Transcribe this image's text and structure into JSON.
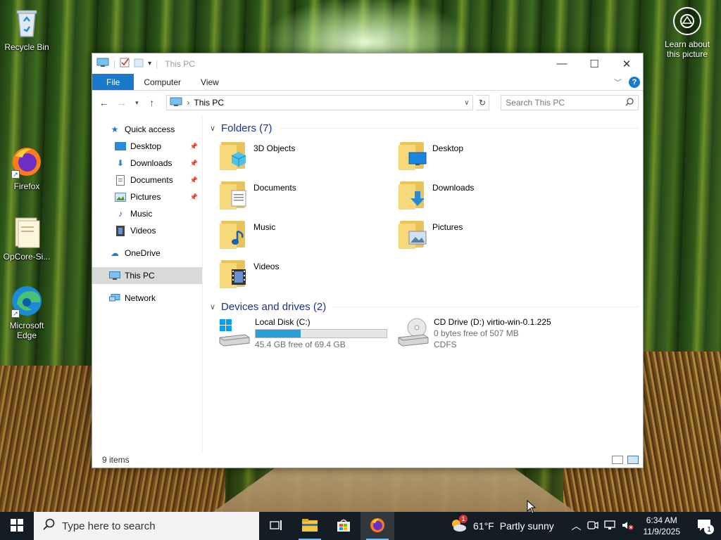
{
  "desktop": {
    "icons": [
      {
        "label": "Recycle Bin",
        "icon": "recycle-bin-icon"
      },
      {
        "label": "Firefox",
        "icon": "firefox-icon"
      },
      {
        "label": "OpCore-Si...",
        "icon": "file-icon"
      },
      {
        "label": "Microsoft Edge",
        "icon": "edge-icon"
      }
    ],
    "learn_about": "Learn about this picture"
  },
  "window": {
    "title": "This PC",
    "ribbon_tabs": [
      "File",
      "Computer",
      "View"
    ],
    "address": {
      "path": "This PC"
    },
    "search": {
      "placeholder": "Search This PC"
    },
    "nav": {
      "quick_access": "Quick access",
      "quick_items": [
        "Desktop",
        "Downloads",
        "Documents",
        "Pictures",
        "Music",
        "Videos"
      ],
      "onedrive": "OneDrive",
      "this_pc": "This PC",
      "network": "Network"
    },
    "folders_header": "Folders (7)",
    "folders": [
      "3D Objects",
      "Desktop",
      "Documents",
      "Downloads",
      "Music",
      "Pictures",
      "Videos"
    ],
    "devices_header": "Devices and drives (2)",
    "drives": [
      {
        "name": "Local Disk (C:)",
        "free": "45.4 GB free of 69.4 GB",
        "used_fraction": 0.346
      },
      {
        "name": "CD Drive (D:) virtio-win-0.1.225",
        "free": "0 bytes free of 507 MB",
        "fs": "CDFS"
      }
    ],
    "status": "9 items"
  },
  "taskbar": {
    "search_placeholder": "Type here to search",
    "weather": {
      "temp": "61°F",
      "condition": "Partly sunny",
      "alert_count": "1"
    },
    "clock": {
      "time": "6:34 AM",
      "date": "11/9/2025"
    },
    "notification_count": "1"
  },
  "colors": {
    "accent": "#1979ca",
    "drive_bar": "#26a0da",
    "group_header": "#1e3287",
    "taskbar": "#141d24"
  }
}
